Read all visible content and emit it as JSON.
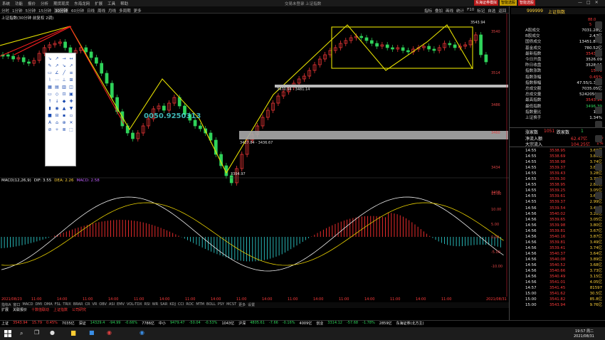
{
  "window": {
    "title": "交易未登录 上证指数",
    "menu": [
      "系统",
      "功能",
      "报价",
      "分析",
      "期货现货",
      "东海龙网",
      "扩展",
      "工具",
      "帮助"
    ],
    "controls": [
      "东海证券模拟",
      "智能选股",
      "智能选股"
    ]
  },
  "toolbar": {
    "periods": [
      "分时",
      "1分钟",
      "5分钟",
      "15分钟",
      "30分钟",
      "60分钟",
      "日线",
      "周线",
      "月线",
      "多周期",
      "更多"
    ],
    "active_period": "30分钟",
    "right": [
      "指标",
      "叠加",
      "画线",
      "统计",
      "F10",
      "标记",
      "自选",
      "返回"
    ]
  },
  "chart_caption": "上证指数(30分钟 前复权 2调)",
  "price_labels": {
    "high": "3543.94",
    "level1": "3470.94 - 3481.14",
    "level2": "3427.84 - 3436.67",
    "low": "3394.97",
    "overlay": "0050.9250313"
  },
  "right_scale": [
    "3540",
    "3514",
    "3486",
    "3460",
    "3434",
    "3408"
  ],
  "macd": {
    "name": "MACD(12,26,9)",
    "dif": "DIF: 3.55",
    "dea": "DEA: 2.26",
    "macd": "MACD: 2.58"
  },
  "macd_scale": [
    "15.00",
    "10.00",
    "5.00",
    "0.00",
    "-5.00",
    "-10.00"
  ],
  "time_axis": [
    "2021/08/23",
    "11:00",
    "14:00",
    "11:00",
    "14:00",
    "11:00",
    "14:00",
    "11:00",
    "14:00",
    "11:00",
    "14:00",
    "11:00",
    "14:00",
    "11:00",
    "14:00",
    "11:00",
    "14:00",
    "11:00",
    "2021/08/31"
  ],
  "indicators": [
    "指标A",
    "窗口",
    "MACD",
    "DMI",
    "DMA",
    "FSL",
    "TRIX",
    "BRAR",
    "CR",
    "VR",
    "OBV",
    "ASI",
    "EMV",
    "VOL-TDX",
    "RSI",
    "WR",
    "SAR",
    "KDJ",
    "CCI",
    "ROC",
    "MTM",
    "BOLL",
    "PSY",
    "MCST",
    "更多",
    "设置"
  ],
  "info_strip": [
    "扩展",
    "关联报价",
    "十数值联动",
    "上证指数",
    "公司研究"
  ],
  "index_bar": [
    {
      "name": "上证",
      "value": "3543.94",
      "change": "15.79",
      "pct": "0.45%",
      "amount": "7035亿"
    },
    {
      "name": "深证",
      "value": "14329.4",
      "change": "-94.99",
      "pct": "-0.66%",
      "amount": "7786亿"
    },
    {
      "name": "中小",
      "value": "9479.47",
      "change": "-50.04",
      "pct": "-0.53%",
      "amount": "1043亿"
    },
    {
      "name": "沪深",
      "value": "4805.61",
      "change": "-7.66",
      "pct": "-0.16%",
      "amount": "4009亿"
    },
    {
      "name": "创业",
      "value": "3314.12",
      "change": "-57.68",
      "pct": "-1.78%",
      "amount": "2859亿"
    }
  ],
  "server": "东海证券(北方主)",
  "taskbar": {
    "time": "19:57 周二",
    "date": "2021/08/31"
  },
  "panel": {
    "code": "999999",
    "name": "上证指数",
    "side": [
      "88.0",
      "5"
    ],
    "rows": [
      {
        "label": "A股成交",
        "value": "7031.28亿",
        "color": "white"
      },
      {
        "label": "B股成交",
        "value": "2.47亿",
        "color": "white"
      },
      {
        "label": "国债成交",
        "value": "13451.88亿",
        "color": "white"
      },
      {
        "label": "基金成交",
        "value": "780.52亿",
        "color": "white"
      },
      {
        "label": "最新指数",
        "value": "3543.94",
        "color": "red"
      },
      {
        "label": "今日开盘",
        "value": "3526.09",
        "color": "white"
      },
      {
        "label": "昨日收盘",
        "value": "3528.15",
        "color": "white"
      },
      {
        "label": "指数涨跌",
        "value": "15.79",
        "color": "red"
      },
      {
        "label": "指数涨幅",
        "value": "0.45%",
        "color": "red"
      },
      {
        "label": "指数振幅",
        "value": "47.55/1.35%",
        "color": "white"
      },
      {
        "label": "总成交额",
        "value": "7035.05亿",
        "color": "white"
      },
      {
        "label": "总成交量",
        "value": "524205056",
        "color": "white"
      },
      {
        "label": "最高指数",
        "value": "3543.94",
        "color": "red"
      },
      {
        "label": "最低指数",
        "value": "3496.39",
        "color": "green"
      },
      {
        "label": "指数量比",
        "value": "1.11",
        "color": "white"
      },
      {
        "label": "上证换手",
        "value": "1.34%",
        "color": "white"
      }
    ],
    "updown": {
      "up_label": "涨家数",
      "up": "1051",
      "down_label": "跌家数",
      "down": "1",
      "flow1_label": "净流入额",
      "flow1": "62.47亿",
      "flow1_n": "1%",
      "flow2_label": "大宗流入",
      "flow2": "104.25亿",
      "flow2_n": "1%"
    },
    "ticks": [
      {
        "t": "14:55",
        "p": "3538.95",
        "v": "3.68亿"
      },
      {
        "t": "14:55",
        "p": "3538.69",
        "v": "3.86亿"
      },
      {
        "t": "14:55",
        "p": "3538.98",
        "v": "3.74亿"
      },
      {
        "t": "14:55",
        "p": "3539.37",
        "v": "3.83亿"
      },
      {
        "t": "14:55",
        "p": "3539.43",
        "v": "3.28亿"
      },
      {
        "t": "14:55",
        "p": "3539.30",
        "v": "3.72亿"
      },
      {
        "t": "14:55",
        "p": "3538.95",
        "v": "2.85亿"
      },
      {
        "t": "14:55",
        "p": "3539.25",
        "v": "3.05亿"
      },
      {
        "t": "14:55",
        "p": "3539.61",
        "v": "3.66亿"
      },
      {
        "t": "14:55",
        "p": "3539.37",
        "v": "2.99亿"
      },
      {
        "t": "14:56",
        "p": "3539.54",
        "v": "3.42亿"
      },
      {
        "t": "14:56",
        "p": "3540.02",
        "v": "3.28亿"
      },
      {
        "t": "14:56",
        "p": "3539.65",
        "v": "3.05亿"
      },
      {
        "t": "14:56",
        "p": "3539.98",
        "v": "3.80亿"
      },
      {
        "t": "14:56",
        "p": "3539.81",
        "v": "3.67亿"
      },
      {
        "t": "14:56",
        "p": "3540.16",
        "v": "3.87亿"
      },
      {
        "t": "14:56",
        "p": "3539.81",
        "v": "3.49亿"
      },
      {
        "t": "14:56",
        "p": "3539.41",
        "v": "3.74亿"
      },
      {
        "t": "14:56",
        "p": "3540.37",
        "v": "3.64亿"
      },
      {
        "t": "14:56",
        "p": "3540.08",
        "v": "3.89亿"
      },
      {
        "t": "14:56",
        "p": "3540.52",
        "v": "3.68亿"
      },
      {
        "t": "14:56",
        "p": "3540.66",
        "v": "3.73亿"
      },
      {
        "t": "14:56",
        "p": "3540.49",
        "v": "3.15亿"
      },
      {
        "t": "14:56",
        "p": "3541.01",
        "v": "4.05亿"
      },
      {
        "t": "14:57",
        "p": "3541.45",
        "v": "81597"
      },
      {
        "t": "15:00",
        "p": "3541.62",
        "v": "30.5亿"
      },
      {
        "t": "15:00",
        "p": "3541.82",
        "v": "85.8亿"
      },
      {
        "t": "15:00",
        "p": "3543.94",
        "v": "9.76亿"
      }
    ]
  },
  "colors": {
    "up": "#ff3b3b",
    "down": "#2fd35a",
    "annot": "#e6e000",
    "trend": "#ff2020"
  }
}
